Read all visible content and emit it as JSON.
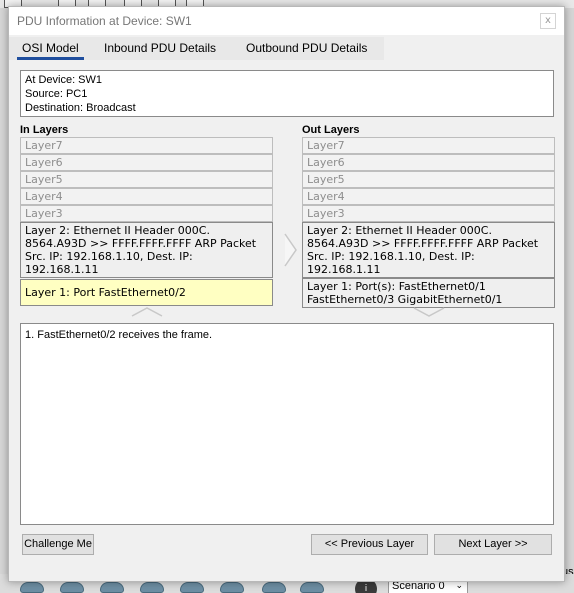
{
  "dialog": {
    "title": "PDU Information at Device: SW1",
    "close_glyph": "x"
  },
  "tabs": [
    {
      "label": "OSI Model",
      "active": true
    },
    {
      "label": "Inbound PDU Details",
      "active": false
    },
    {
      "label": "Outbound PDU Details",
      "active": false
    }
  ],
  "info": {
    "line1": "At Device: SW1",
    "line2": "Source: PC1",
    "line3": "Destination: Broadcast"
  },
  "in_layers": {
    "heading": "In Layers",
    "layer7": "Layer7",
    "layer6": "Layer6",
    "layer5": "Layer5",
    "layer4": "Layer4",
    "layer3": "Layer3",
    "layer2": "Layer 2: Ethernet II Header 000C.\n8564.A93D >> FFFF.FFFF.FFFF ARP Packet\nSrc. IP: 192.168.1.10, Dest. IP:\n192.168.1.11",
    "layer1": "Layer 1: Port FastEthernet0/2"
  },
  "out_layers": {
    "heading": "Out Layers",
    "layer7": "Layer7",
    "layer6": "Layer6",
    "layer5": "Layer5",
    "layer4": "Layer4",
    "layer3": "Layer3",
    "layer2": "Layer 2: Ethernet II Header 000C.\n8564.A93D >> FFFF.FFFF.FFFF ARP Packet\nSrc. IP: 192.168.1.10, Dest. IP:\n192.168.1.11",
    "layer1": "Layer 1: Port(s): FastEthernet0/1\nFastEthernet0/3 GigabitEthernet0/1"
  },
  "description": "1. FastEthernet0/2 receives the frame.",
  "buttons": {
    "challenge": "Challenge Me",
    "previous": "<< Previous Layer",
    "next": "Next Layer >>"
  },
  "background": {
    "scenario": "Scenario 0",
    "right_text": "us"
  },
  "colors": {
    "active_tab_underline": "#1f4e9e",
    "selected_layer": "#ffffc2"
  }
}
